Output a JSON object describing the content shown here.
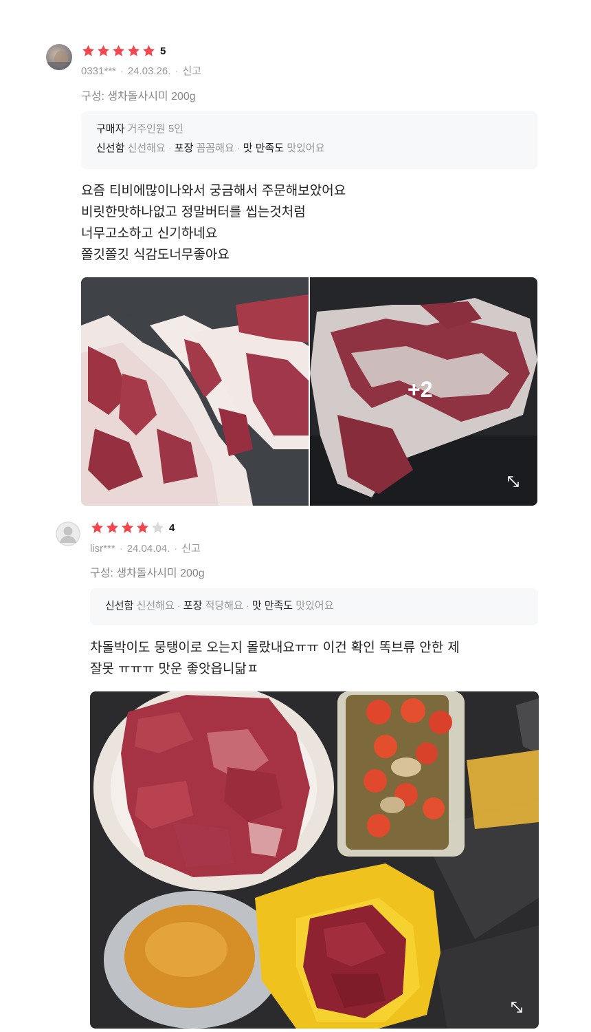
{
  "reviews": [
    {
      "rating": "5",
      "user": "0331***",
      "date": "24.03.26.",
      "report": "신고",
      "option": "구성: 생차돌사시미 200g",
      "buyer_label": "구매자",
      "buyer_value": "거주인원 5인",
      "freshness_label": "신선함",
      "freshness_value": "신선해요",
      "packing_label": "포장",
      "packing_value": "꼼꼼해요",
      "taste_label": "맛 만족도",
      "taste_value": "맛있어요",
      "body": "요즘 티비에많이나와서 궁금해서 주문해보았어요\n비릿한맛하나없고 정말버터를 씹는것처럼\n너무고소하고 신기하네요\n쫄깃쫄깃 식감도너무좋아요",
      "more_photos": "+2"
    },
    {
      "rating": "4",
      "user": "lisr***",
      "date": "24.04.04.",
      "report": "신고",
      "option": "구성: 생차돌사시미 200g",
      "freshness_label": "신선함",
      "freshness_value": "신선해요",
      "packing_label": "포장",
      "packing_value": "적당해요",
      "taste_label": "맛 만족도",
      "taste_value": "맛있어요",
      "body": "차돌박이도 뭉탱이로 오는지 몰랐내요ㅠㅠ 이건 확인 똑브류 안한 제\n잘못 ㅠㅠㅠ 맛운 좋앗읍니닮ㅍ"
    }
  ],
  "colors": {
    "star_on": "#f2474f",
    "star_off": "#d9d9d9"
  },
  "icons": {
    "star": "star-icon",
    "expand": "expand-icon",
    "avatar": "default-avatar-icon"
  }
}
